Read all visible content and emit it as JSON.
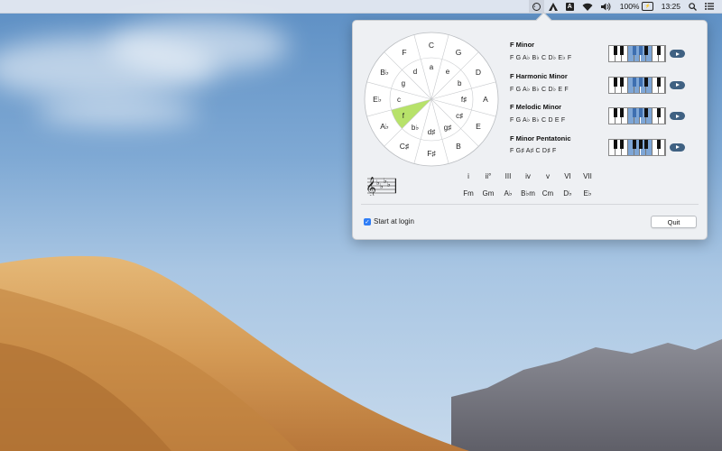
{
  "menubar": {
    "battery_percent": "100%",
    "clock": "13:25",
    "input_letter": "A"
  },
  "wheel": {
    "major_keys": [
      "C",
      "G",
      "D",
      "A",
      "E",
      "B",
      "F♯",
      "C♯",
      "A♭",
      "E♭",
      "B♭",
      "F"
    ],
    "minor_keys": [
      "a",
      "e",
      "b",
      "f♯",
      "c♯",
      "g♯",
      "d♯",
      "b♭",
      "f",
      "c",
      "g",
      "d"
    ],
    "selected_key": "f",
    "highlight_color": "#b7e26a"
  },
  "scales": [
    {
      "name": "F Minor",
      "notes": "F  G  A♭ B♭ C  D♭ E♭ F",
      "highlight": [
        0,
        1,
        2,
        3,
        4,
        5,
        6
      ]
    },
    {
      "name": "F Harmonic Minor",
      "notes": "F  G  A♭ B♭ C  D♭ E  F",
      "highlight": [
        0,
        1,
        2,
        3,
        4,
        5,
        6
      ]
    },
    {
      "name": "F Melodic Minor",
      "notes": "F  G  A♭ B♭ C  D  E  F",
      "highlight": [
        0,
        1,
        2,
        3,
        4,
        5,
        6
      ]
    },
    {
      "name": "F Minor Pentatonic",
      "notes": "F  G♯ A♯ C  D♯ F",
      "highlight": [
        0,
        1,
        2,
        3,
        4
      ]
    }
  ],
  "harmony": {
    "numerals": [
      "i",
      "ii°",
      "III",
      "iv",
      "v",
      "VI",
      "VII"
    ],
    "chords": [
      "Fm",
      "Gm",
      "A♭",
      "B♭m",
      "Cm",
      "D♭",
      "E♭"
    ]
  },
  "footer": {
    "start_at_login_label": "Start at login",
    "start_at_login_checked": true,
    "quit_label": "Quit"
  }
}
